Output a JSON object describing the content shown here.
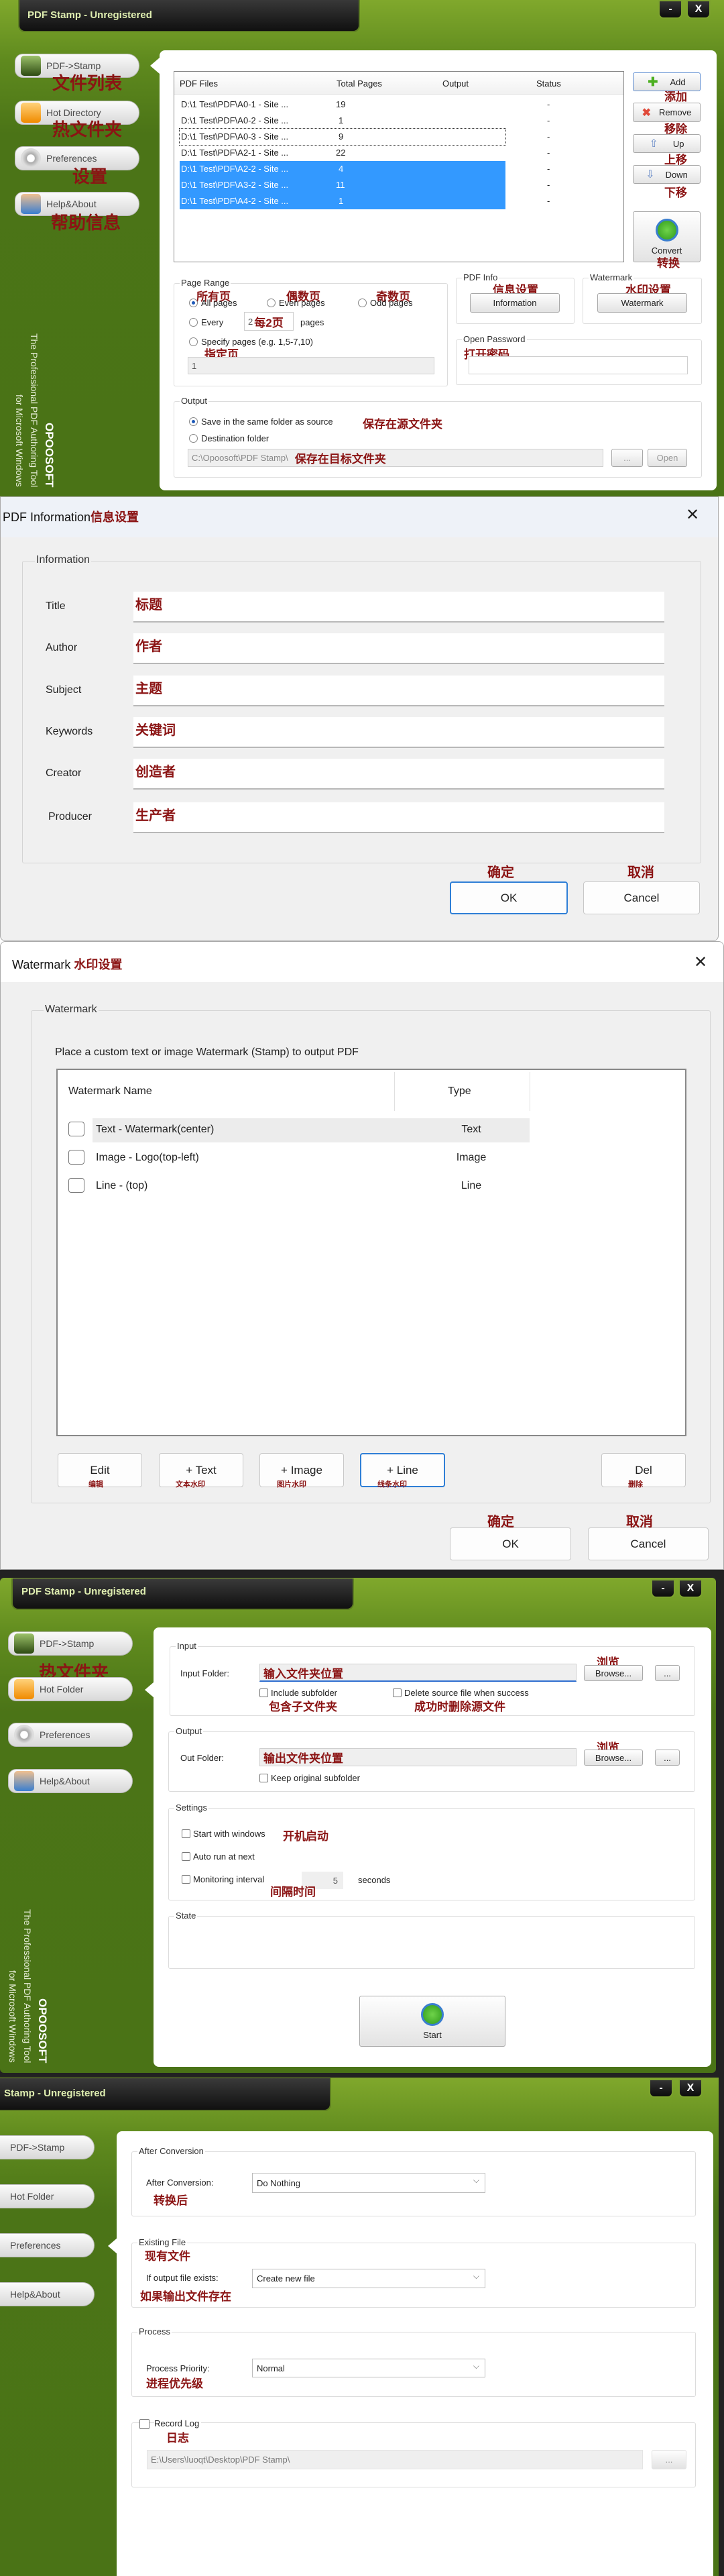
{
  "main_window": {
    "title": "PDF Stamp - Unregistered",
    "minimize": "-",
    "close": "X",
    "sidebar": [
      {
        "label": "PDF->Stamp",
        "note": "文件列表"
      },
      {
        "label": "Hot Directory",
        "note": "热文件夹"
      },
      {
        "label": "Preferences",
        "note": "设置"
      },
      {
        "label": "Help&About",
        "note": "帮助信息"
      }
    ],
    "brand": {
      "name": "OPOOSOFT",
      "line1": "The Professional PDF Authoring Tool",
      "line2": "for Microsoft Windows"
    },
    "file_list": {
      "columns": [
        "PDF Files",
        "Total Pages",
        "Output",
        "Status"
      ],
      "rows": [
        {
          "file": "D:\\1 Test\\PDF\\A0-1 - Site ...",
          "pages": "19",
          "output": "",
          "status": "-",
          "selected": false
        },
        {
          "file": "D:\\1 Test\\PDF\\A0-2 - Site ...",
          "pages": "1",
          "output": "",
          "status": "-",
          "selected": false
        },
        {
          "file": "D:\\1 Test\\PDF\\A0-3 - Site ...",
          "pages": "9",
          "output": "",
          "status": "-",
          "selected": false
        },
        {
          "file": "D:\\1 Test\\PDF\\A2-1 - Site ...",
          "pages": "22",
          "output": "",
          "status": "-",
          "selected": false
        },
        {
          "file": "D:\\1 Test\\PDF\\A2-2 - Site ...",
          "pages": "4",
          "output": "",
          "status": "-",
          "selected": true
        },
        {
          "file": "D:\\1 Test\\PDF\\A3-2 - Site ...",
          "pages": "11",
          "output": "",
          "status": "-",
          "selected": true
        },
        {
          "file": "D:\\1 Test\\PDF\\A4-2 - Site ...",
          "pages": "1",
          "output": "",
          "status": "-",
          "selected": true
        }
      ]
    },
    "actions": [
      {
        "label": "Add",
        "note": "添加"
      },
      {
        "label": "Remove",
        "note": "移除"
      },
      {
        "label": "Up",
        "note": "上移"
      },
      {
        "label": "Down",
        "note": "下移"
      }
    ],
    "convert": {
      "label": "Convert",
      "note": "转换"
    },
    "page_range": {
      "title": "Page Range",
      "all": "All pages",
      "all_note": "所有页",
      "even": "Even pages",
      "even_note": "偶数页",
      "odd": "Odd pages",
      "odd_note": "奇数页",
      "every": "Every",
      "every_value": "2",
      "every_note": "每2页",
      "pages": "pages",
      "specify": "Specify pages (e.g. 1,5-7,10)",
      "specify_note": "指定页",
      "specify_value": "1",
      "selected": "All pages"
    },
    "pdf_info": {
      "title": "PDF Info",
      "note": "信息设置",
      "button": "Information"
    },
    "watermark": {
      "title": "Watermark",
      "note": "水印设置",
      "button": "Watermark"
    },
    "open_password": {
      "title": "Open Password",
      "note": "打开密码",
      "value": ""
    },
    "output": {
      "title": "Output",
      "same_folder": "Save in the same folder as source",
      "same_note": "保存在源文件夹",
      "destination": "Destination folder",
      "path": "C:\\Opoosoft\\PDF Stamp\\",
      "path_note": "保存在目标文件夹",
      "browse": "...",
      "open": "Open"
    }
  },
  "info_dialog": {
    "title": "PDF Information",
    "title_note": "信息设置",
    "close": "✕",
    "group": "Information",
    "fields": [
      {
        "label": "Title",
        "value": "标题"
      },
      {
        "label": "Author",
        "value": "作者"
      },
      {
        "label": "Subject",
        "value": "主题"
      },
      {
        "label": "Keywords",
        "value": "关键词"
      },
      {
        "label": "Creator",
        "value": "创造者"
      },
      {
        "label": "Producer",
        "value": "生产者"
      }
    ],
    "ok": "OK",
    "ok_note": "确定",
    "cancel": "Cancel",
    "cancel_note": "取消"
  },
  "watermark_dialog": {
    "title": "Watermark",
    "title_note": "水印设置",
    "close": "✕",
    "group": "Watermark",
    "description": "Place a custom text or image Watermark (Stamp) to output PDF",
    "columns": [
      "Watermark Name",
      "Type"
    ],
    "rows": [
      {
        "name": "Text - Watermark(center)",
        "type": "Text",
        "checked": false
      },
      {
        "name": "Image - Logo(top-left)",
        "type": "Image",
        "checked": false
      },
      {
        "name": "Line - (top)",
        "type": "Line",
        "checked": false
      }
    ],
    "buttons": [
      {
        "label": "Edit",
        "note": "编辑"
      },
      {
        "label": "+ Text",
        "note": "文本水印"
      },
      {
        "label": "+ Image",
        "note": "图片水印"
      },
      {
        "label": "+ Line",
        "note": "线条水印"
      },
      {
        "label": "Del",
        "note": "删除"
      }
    ],
    "ok": "OK",
    "ok_note": "确定",
    "cancel": "Cancel",
    "cancel_note": "取消"
  },
  "hot_folder_window": {
    "title": "PDF Stamp - Unregistered",
    "minimize": "-",
    "close": "X",
    "sidebar": [
      "PDF->Stamp",
      "Hot Folder",
      "Preferences",
      "Help&About"
    ],
    "sidebar_note": "热文件夹",
    "brand": {
      "name": "OPOOSOFT",
      "line1": "The Professional PDF Authoring Tool",
      "line2": "for Microsoft Windows"
    },
    "input": {
      "title": "Input",
      "label": "Input Folder:",
      "value": "输入文件夹位置",
      "browse": "Browse...",
      "browse_note": "浏览",
      "more": "...",
      "include_subfolder": "Include subfolder",
      "include_note": "包含子文件夹",
      "delete_source": "Delete source file when success",
      "delete_note": "成功时删除源文件"
    },
    "output": {
      "title": "Output",
      "label": "Out Folder:",
      "value": "输出文件夹位置",
      "browse": "Browse...",
      "browse_note": "浏览",
      "more": "...",
      "keep_subfolder": "Keep original subfolder"
    },
    "settings": {
      "title": "Settings",
      "start_windows": "Start with windows",
      "start_note": "开机启动",
      "auto_run": "Auto run at next",
      "monitoring": "Monitoring interval",
      "monitoring_value": "5",
      "seconds": "seconds",
      "monitoring_note": "间隔时间"
    },
    "state": {
      "title": "State"
    },
    "start": "Start"
  },
  "preferences_window": {
    "title": "Stamp - Unregistered",
    "minimize": "-",
    "close": "X",
    "sidebar": [
      "PDF->Stamp",
      "Hot Folder",
      "Preferences",
      "Help&About"
    ],
    "after_conversion": {
      "title": "After Conversion",
      "label": "After Conversion:",
      "note": "转换后",
      "value": "Do Nothing"
    },
    "existing_file": {
      "title": "Existing File",
      "title_note": "现有文件",
      "label": "If output file exists:",
      "note": "如果输出文件存在",
      "value": "Create new file"
    },
    "process": {
      "title": "Process",
      "label": "Process Priority:",
      "note": "进程优先级",
      "value": "Normal"
    },
    "record_log": {
      "label": "Record Log",
      "note": "日志",
      "path": "E:\\Users\\luoqt\\Desktop\\PDF Stamp\\",
      "more": "..."
    }
  }
}
